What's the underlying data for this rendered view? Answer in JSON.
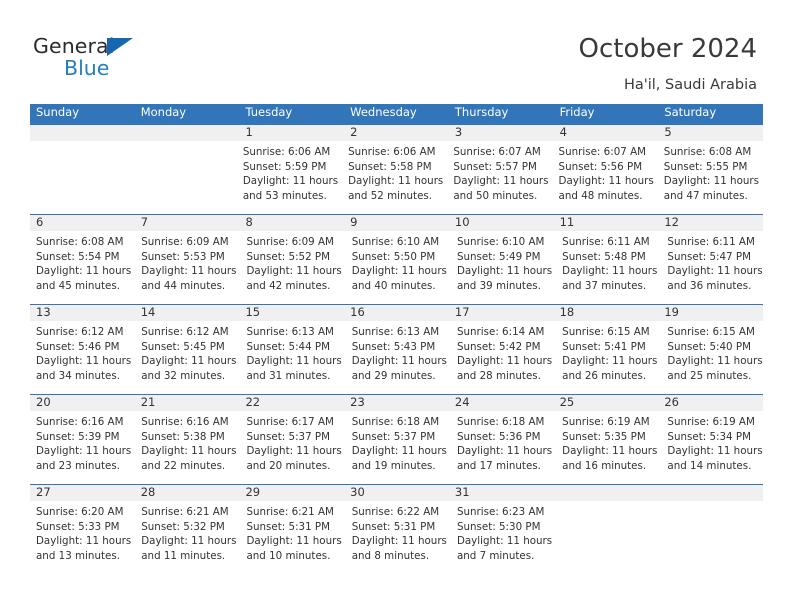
{
  "brand": {
    "word_one": "General",
    "word_two": "Blue",
    "triangle_icon": "blue-triangle-logo-icon",
    "color_dark": "#2b2b2b",
    "color_blue": "#1f7ec4"
  },
  "header": {
    "title": "October 2024",
    "subtitle": "Ha'il, Saudi Arabia"
  },
  "theme": {
    "header_blue": "#3275b8",
    "daynum_band": "#f0f0f0",
    "text": "#333333",
    "cell_bg": "#ffffff"
  },
  "calendar": {
    "weekday_headers": [
      "Sunday",
      "Monday",
      "Tuesday",
      "Wednesday",
      "Thursday",
      "Friday",
      "Saturday"
    ],
    "weeks": [
      [
        {
          "day": "",
          "sunrise": "",
          "sunset": "",
          "daylight_line1": "",
          "daylight_line2": "",
          "blank": true
        },
        {
          "day": "",
          "sunrise": "",
          "sunset": "",
          "daylight_line1": "",
          "daylight_line2": "",
          "blank": true
        },
        {
          "day": "1",
          "sunrise": "Sunrise: 6:06 AM",
          "sunset": "Sunset: 5:59 PM",
          "daylight_line1": "Daylight: 11 hours",
          "daylight_line2": "and 53 minutes.",
          "blank": false
        },
        {
          "day": "2",
          "sunrise": "Sunrise: 6:06 AM",
          "sunset": "Sunset: 5:58 PM",
          "daylight_line1": "Daylight: 11 hours",
          "daylight_line2": "and 52 minutes.",
          "blank": false
        },
        {
          "day": "3",
          "sunrise": "Sunrise: 6:07 AM",
          "sunset": "Sunset: 5:57 PM",
          "daylight_line1": "Daylight: 11 hours",
          "daylight_line2": "and 50 minutes.",
          "blank": false
        },
        {
          "day": "4",
          "sunrise": "Sunrise: 6:07 AM",
          "sunset": "Sunset: 5:56 PM",
          "daylight_line1": "Daylight: 11 hours",
          "daylight_line2": "and 48 minutes.",
          "blank": false
        },
        {
          "day": "5",
          "sunrise": "Sunrise: 6:08 AM",
          "sunset": "Sunset: 5:55 PM",
          "daylight_line1": "Daylight: 11 hours",
          "daylight_line2": "and 47 minutes.",
          "blank": false
        }
      ],
      [
        {
          "day": "6",
          "sunrise": "Sunrise: 6:08 AM",
          "sunset": "Sunset: 5:54 PM",
          "daylight_line1": "Daylight: 11 hours",
          "daylight_line2": "and 45 minutes.",
          "blank": false
        },
        {
          "day": "7",
          "sunrise": "Sunrise: 6:09 AM",
          "sunset": "Sunset: 5:53 PM",
          "daylight_line1": "Daylight: 11 hours",
          "daylight_line2": "and 44 minutes.",
          "blank": false
        },
        {
          "day": "8",
          "sunrise": "Sunrise: 6:09 AM",
          "sunset": "Sunset: 5:52 PM",
          "daylight_line1": "Daylight: 11 hours",
          "daylight_line2": "and 42 minutes.",
          "blank": false
        },
        {
          "day": "9",
          "sunrise": "Sunrise: 6:10 AM",
          "sunset": "Sunset: 5:50 PM",
          "daylight_line1": "Daylight: 11 hours",
          "daylight_line2": "and 40 minutes.",
          "blank": false
        },
        {
          "day": "10",
          "sunrise": "Sunrise: 6:10 AM",
          "sunset": "Sunset: 5:49 PM",
          "daylight_line1": "Daylight: 11 hours",
          "daylight_line2": "and 39 minutes.",
          "blank": false
        },
        {
          "day": "11",
          "sunrise": "Sunrise: 6:11 AM",
          "sunset": "Sunset: 5:48 PM",
          "daylight_line1": "Daylight: 11 hours",
          "daylight_line2": "and 37 minutes.",
          "blank": false
        },
        {
          "day": "12",
          "sunrise": "Sunrise: 6:11 AM",
          "sunset": "Sunset: 5:47 PM",
          "daylight_line1": "Daylight: 11 hours",
          "daylight_line2": "and 36 minutes.",
          "blank": false
        }
      ],
      [
        {
          "day": "13",
          "sunrise": "Sunrise: 6:12 AM",
          "sunset": "Sunset: 5:46 PM",
          "daylight_line1": "Daylight: 11 hours",
          "daylight_line2": "and 34 minutes.",
          "blank": false
        },
        {
          "day": "14",
          "sunrise": "Sunrise: 6:12 AM",
          "sunset": "Sunset: 5:45 PM",
          "daylight_line1": "Daylight: 11 hours",
          "daylight_line2": "and 32 minutes.",
          "blank": false
        },
        {
          "day": "15",
          "sunrise": "Sunrise: 6:13 AM",
          "sunset": "Sunset: 5:44 PM",
          "daylight_line1": "Daylight: 11 hours",
          "daylight_line2": "and 31 minutes.",
          "blank": false
        },
        {
          "day": "16",
          "sunrise": "Sunrise: 6:13 AM",
          "sunset": "Sunset: 5:43 PM",
          "daylight_line1": "Daylight: 11 hours",
          "daylight_line2": "and 29 minutes.",
          "blank": false
        },
        {
          "day": "17",
          "sunrise": "Sunrise: 6:14 AM",
          "sunset": "Sunset: 5:42 PM",
          "daylight_line1": "Daylight: 11 hours",
          "daylight_line2": "and 28 minutes.",
          "blank": false
        },
        {
          "day": "18",
          "sunrise": "Sunrise: 6:15 AM",
          "sunset": "Sunset: 5:41 PM",
          "daylight_line1": "Daylight: 11 hours",
          "daylight_line2": "and 26 minutes.",
          "blank": false
        },
        {
          "day": "19",
          "sunrise": "Sunrise: 6:15 AM",
          "sunset": "Sunset: 5:40 PM",
          "daylight_line1": "Daylight: 11 hours",
          "daylight_line2": "and 25 minutes.",
          "blank": false
        }
      ],
      [
        {
          "day": "20",
          "sunrise": "Sunrise: 6:16 AM",
          "sunset": "Sunset: 5:39 PM",
          "daylight_line1": "Daylight: 11 hours",
          "daylight_line2": "and 23 minutes.",
          "blank": false
        },
        {
          "day": "21",
          "sunrise": "Sunrise: 6:16 AM",
          "sunset": "Sunset: 5:38 PM",
          "daylight_line1": "Daylight: 11 hours",
          "daylight_line2": "and 22 minutes.",
          "blank": false
        },
        {
          "day": "22",
          "sunrise": "Sunrise: 6:17 AM",
          "sunset": "Sunset: 5:37 PM",
          "daylight_line1": "Daylight: 11 hours",
          "daylight_line2": "and 20 minutes.",
          "blank": false
        },
        {
          "day": "23",
          "sunrise": "Sunrise: 6:18 AM",
          "sunset": "Sunset: 5:37 PM",
          "daylight_line1": "Daylight: 11 hours",
          "daylight_line2": "and 19 minutes.",
          "blank": false
        },
        {
          "day": "24",
          "sunrise": "Sunrise: 6:18 AM",
          "sunset": "Sunset: 5:36 PM",
          "daylight_line1": "Daylight: 11 hours",
          "daylight_line2": "and 17 minutes.",
          "blank": false
        },
        {
          "day": "25",
          "sunrise": "Sunrise: 6:19 AM",
          "sunset": "Sunset: 5:35 PM",
          "daylight_line1": "Daylight: 11 hours",
          "daylight_line2": "and 16 minutes.",
          "blank": false
        },
        {
          "day": "26",
          "sunrise": "Sunrise: 6:19 AM",
          "sunset": "Sunset: 5:34 PM",
          "daylight_line1": "Daylight: 11 hours",
          "daylight_line2": "and 14 minutes.",
          "blank": false
        }
      ],
      [
        {
          "day": "27",
          "sunrise": "Sunrise: 6:20 AM",
          "sunset": "Sunset: 5:33 PM",
          "daylight_line1": "Daylight: 11 hours",
          "daylight_line2": "and 13 minutes.",
          "blank": false
        },
        {
          "day": "28",
          "sunrise": "Sunrise: 6:21 AM",
          "sunset": "Sunset: 5:32 PM",
          "daylight_line1": "Daylight: 11 hours",
          "daylight_line2": "and 11 minutes.",
          "blank": false
        },
        {
          "day": "29",
          "sunrise": "Sunrise: 6:21 AM",
          "sunset": "Sunset: 5:31 PM",
          "daylight_line1": "Daylight: 11 hours",
          "daylight_line2": "and 10 minutes.",
          "blank": false
        },
        {
          "day": "30",
          "sunrise": "Sunrise: 6:22 AM",
          "sunset": "Sunset: 5:31 PM",
          "daylight_line1": "Daylight: 11 hours",
          "daylight_line2": "and 8 minutes.",
          "blank": false
        },
        {
          "day": "31",
          "sunrise": "Sunrise: 6:23 AM",
          "sunset": "Sunset: 5:30 PM",
          "daylight_line1": "Daylight: 11 hours",
          "daylight_line2": "and 7 minutes.",
          "blank": false
        },
        {
          "day": "",
          "sunrise": "",
          "sunset": "",
          "daylight_line1": "",
          "daylight_line2": "",
          "blank": true
        },
        {
          "day": "",
          "sunrise": "",
          "sunset": "",
          "daylight_line1": "",
          "daylight_line2": "",
          "blank": true
        }
      ]
    ]
  }
}
